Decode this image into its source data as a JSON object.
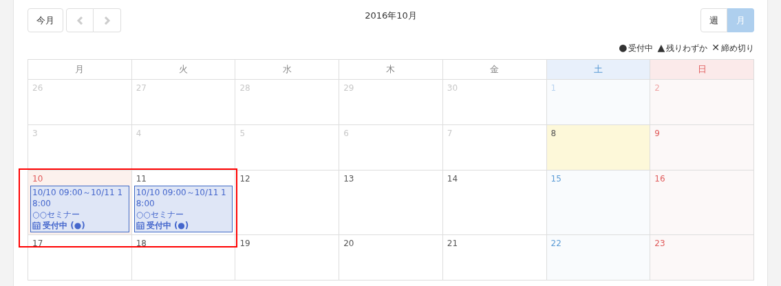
{
  "toolbar": {
    "today_button": "今月",
    "title": "2016年10月",
    "views": [
      {
        "label": "週",
        "selected": false
      },
      {
        "label": "月",
        "selected": true
      }
    ]
  },
  "legend": [
    {
      "symbol": "●",
      "label": "受付中"
    },
    {
      "symbol": "▲",
      "label": "残りわずか"
    },
    {
      "symbol": "✕",
      "label": "締め切り"
    }
  ],
  "weekdays": [
    {
      "label": "月",
      "kind": "weekday"
    },
    {
      "label": "火",
      "kind": "weekday"
    },
    {
      "label": "水",
      "kind": "weekday"
    },
    {
      "label": "木",
      "kind": "weekday"
    },
    {
      "label": "金",
      "kind": "weekday"
    },
    {
      "label": "土",
      "kind": "saturday"
    },
    {
      "label": "日",
      "kind": "sunday"
    }
  ],
  "weeks": [
    [
      {
        "day": "26",
        "other_month": true,
        "today": false,
        "holiday": false
      },
      {
        "day": "27",
        "other_month": true,
        "today": false,
        "holiday": false
      },
      {
        "day": "28",
        "other_month": true,
        "today": false,
        "holiday": false
      },
      {
        "day": "29",
        "other_month": true,
        "today": false,
        "holiday": false
      },
      {
        "day": "30",
        "other_month": true,
        "today": false,
        "holiday": false
      },
      {
        "day": "1",
        "other_month": true,
        "today": false,
        "holiday": false
      },
      {
        "day": "2",
        "other_month": true,
        "today": false,
        "holiday": false
      }
    ],
    [
      {
        "day": "3",
        "other_month": true,
        "today": false,
        "holiday": false
      },
      {
        "day": "4",
        "other_month": true,
        "today": false,
        "holiday": false
      },
      {
        "day": "5",
        "other_month": true,
        "today": false,
        "holiday": false
      },
      {
        "day": "6",
        "other_month": true,
        "today": false,
        "holiday": false
      },
      {
        "day": "7",
        "other_month": true,
        "today": false,
        "holiday": false
      },
      {
        "day": "8",
        "other_month": false,
        "today": true,
        "holiday": false
      },
      {
        "day": "9",
        "other_month": false,
        "today": false,
        "holiday": false
      }
    ],
    [
      {
        "day": "10",
        "other_month": false,
        "today": false,
        "holiday": true,
        "events": [
          {
            "time": "10/10 09:00～10/11 18:00",
            "title": "○○セミナー",
            "status": "受付中 (●)"
          }
        ]
      },
      {
        "day": "11",
        "other_month": false,
        "today": false,
        "holiday": false,
        "events": [
          {
            "time": "10/10 09:00～10/11 18:00",
            "title": "○○セミナー",
            "status": "受付中 (●)"
          }
        ]
      },
      {
        "day": "12",
        "other_month": false,
        "today": false,
        "holiday": false
      },
      {
        "day": "13",
        "other_month": false,
        "today": false,
        "holiday": false
      },
      {
        "day": "14",
        "other_month": false,
        "today": false,
        "holiday": false
      },
      {
        "day": "15",
        "other_month": false,
        "today": false,
        "holiday": false
      },
      {
        "day": "16",
        "other_month": false,
        "today": false,
        "holiday": false
      }
    ],
    [
      {
        "day": "17",
        "other_month": false,
        "today": false,
        "holiday": false
      },
      {
        "day": "18",
        "other_month": false,
        "today": false,
        "holiday": false
      },
      {
        "day": "19",
        "other_month": false,
        "today": false,
        "holiday": false
      },
      {
        "day": "20",
        "other_month": false,
        "today": false,
        "holiday": false
      },
      {
        "day": "21",
        "other_month": false,
        "today": false,
        "holiday": false
      },
      {
        "day": "22",
        "other_month": false,
        "today": false,
        "holiday": false
      },
      {
        "day": "23",
        "other_month": false,
        "today": false,
        "holiday": false
      }
    ]
  ]
}
